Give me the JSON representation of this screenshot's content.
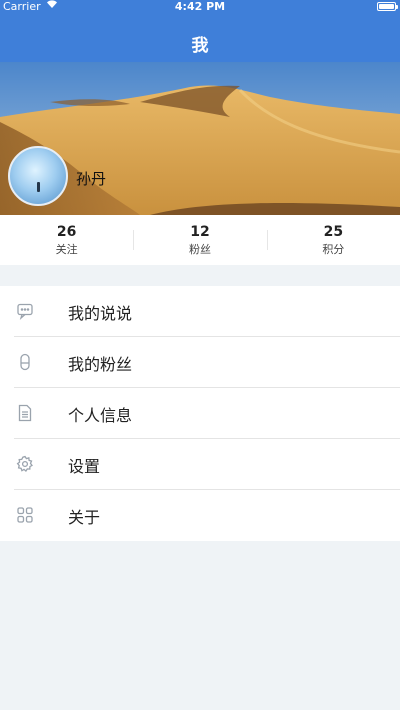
{
  "status_bar": {
    "carrier": "Carrier",
    "time": "4:42 PM",
    "battery_level": 1.0
  },
  "nav": {
    "title": "我"
  },
  "profile": {
    "name": "孙丹"
  },
  "stats": [
    {
      "value": "26",
      "label": "关注"
    },
    {
      "value": "12",
      "label": "粉丝"
    },
    {
      "value": "25",
      "label": "积分"
    }
  ],
  "menu": [
    {
      "label": "我的说说",
      "icon": "message-icon"
    },
    {
      "label": "我的粉丝",
      "icon": "person-icon"
    },
    {
      "label": "个人信息",
      "icon": "document-icon"
    },
    {
      "label": "设置",
      "icon": "gear-icon"
    },
    {
      "label": "关于",
      "icon": "grid-icon"
    }
  ],
  "colors": {
    "nav": "#3f7fd9",
    "background": "#eff3f6",
    "icon": "#9aa3ad"
  }
}
